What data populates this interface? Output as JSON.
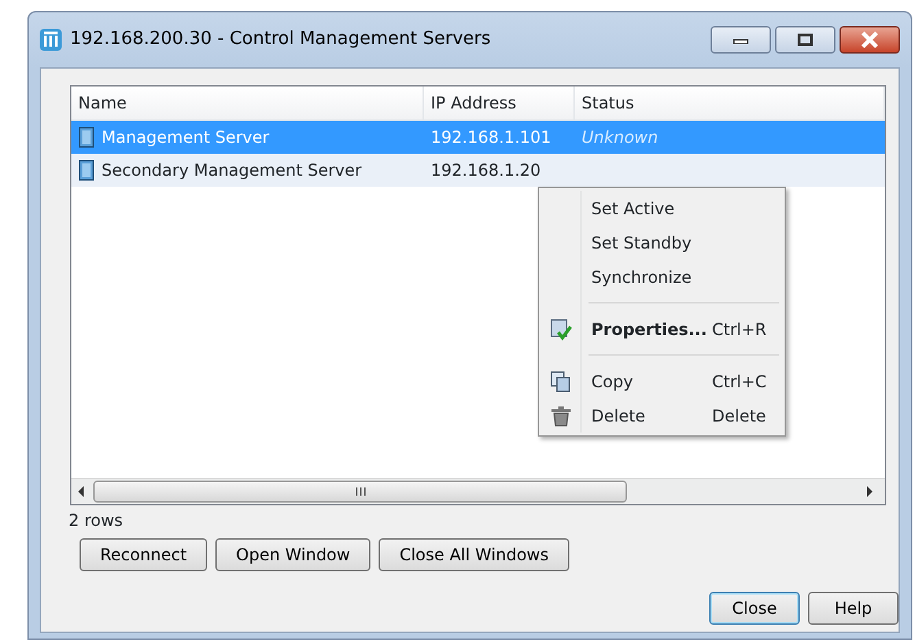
{
  "window": {
    "title": "192.168.200.30 - Control Management Servers"
  },
  "table": {
    "columns": [
      "Name",
      "IP Address",
      "Status"
    ],
    "rows": [
      {
        "name": "Management Server",
        "ip": "192.168.1.101",
        "status": "Unknown",
        "selected": true
      },
      {
        "name": "Secondary Management Server",
        "ip": "192.168.1.20",
        "selected": false
      }
    ]
  },
  "row_count": "2 rows",
  "buttons": [
    {
      "label": "Reconnect"
    },
    {
      "label": "Open Window"
    },
    {
      "label": "Close All Windows"
    }
  ],
  "dialog_buttons": [
    {
      "label": "Close",
      "default": true
    },
    {
      "label": "Help",
      "default": false
    }
  ],
  "context_menu": [
    {
      "kind": "item",
      "label": "Set Active"
    },
    {
      "kind": "item",
      "label": "Set Standby"
    },
    {
      "kind": "item",
      "label": "Synchronize"
    },
    {
      "kind": "separator"
    },
    {
      "kind": "properties",
      "label": "Properties...",
      "shortcut": "Ctrl+R",
      "bold": true
    },
    {
      "kind": "separator"
    },
    {
      "kind": "copy",
      "label": "Copy",
      "shortcut": "Ctrl+C"
    },
    {
      "kind": "delete",
      "label": "Delete",
      "shortcut": "Delete"
    }
  ]
}
